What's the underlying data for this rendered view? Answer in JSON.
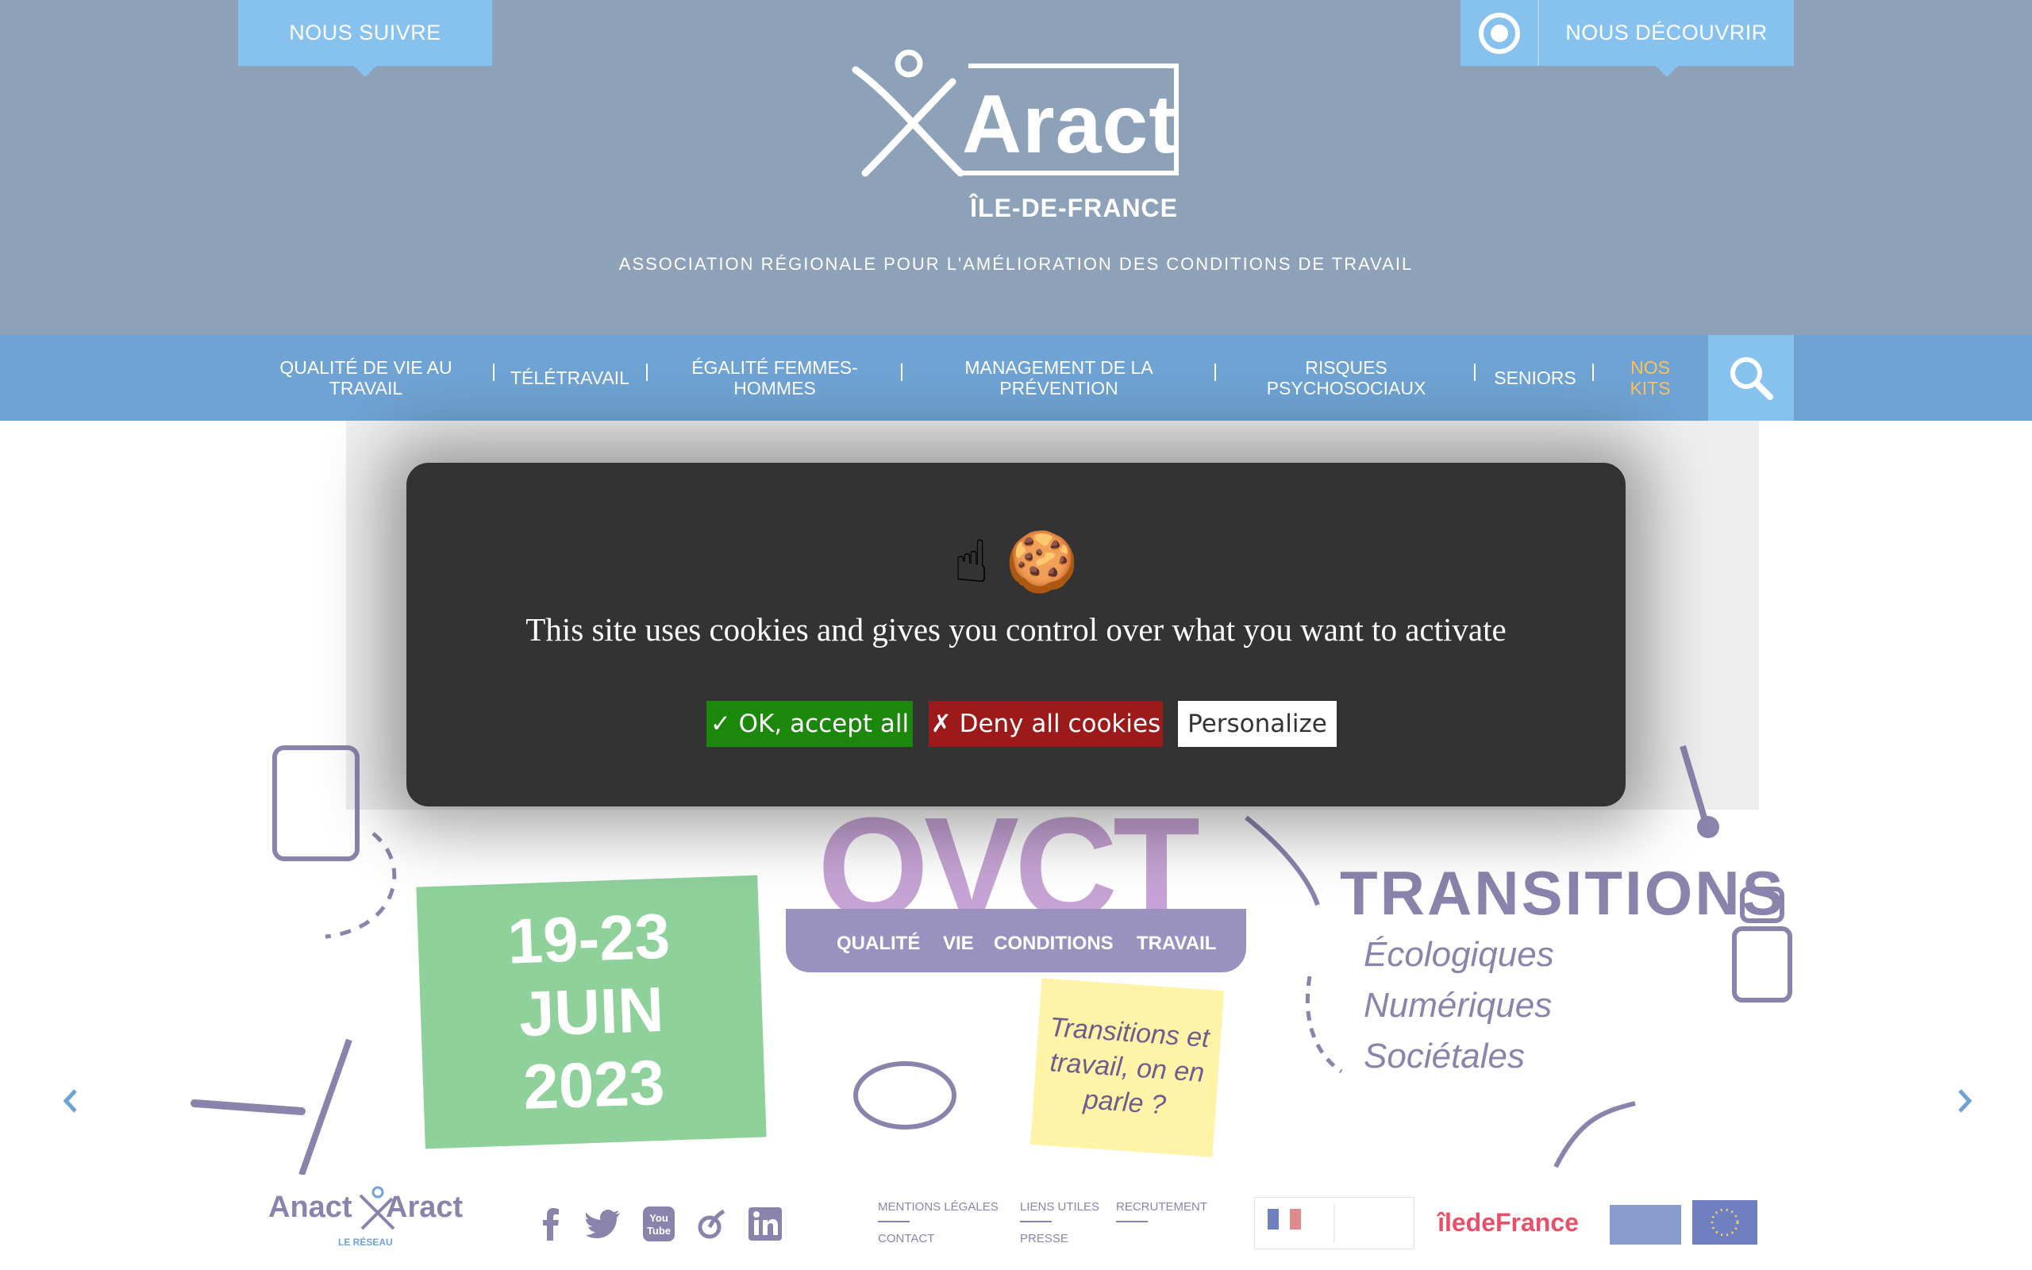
{
  "header": {
    "follow_label": "NOUS SUIVRE",
    "discover_label": "NOUS DÉCOUVRIR",
    "logo_word": "Aract",
    "logo_region": "ÎLE-DE-FRANCE",
    "tagline": "ASSOCIATION RÉGIONALE POUR L'AMÉLIORATION DES CONDITIONS DE TRAVAIL"
  },
  "nav": {
    "items": [
      {
        "label": "QUALITÉ DE VIE AU TRAVAIL"
      },
      {
        "label": "TÉLÉTRAVAIL"
      },
      {
        "label": "ÉGALITÉ FEMMES-HOMMES"
      },
      {
        "label": "MANAGEMENT DE LA PRÉVENTION"
      },
      {
        "label": "RISQUES PSYCHOSOCIAUX"
      },
      {
        "label": "SENIORS"
      },
      {
        "label": "NOS KITS"
      }
    ]
  },
  "hero": {
    "date_line1": "19-23",
    "date_line2": "JUIN",
    "date_line3": "2023",
    "qvct_letters": "QVCT",
    "qvct_q": "QUALITÉ",
    "qvct_v": "VIE",
    "qvct_c": "CONDITIONS",
    "qvct_t": "TRAVAIL",
    "postit_text": "Transitions et travail, on en parle ?",
    "transitions_title": "TRANSITIONS",
    "transitions_items": [
      "Écologiques",
      "Numériques",
      "Sociétales"
    ]
  },
  "cookie": {
    "emoji": "☝ 🍪",
    "message": "This site uses cookies and gives you control over what you want to activate",
    "accept_label": "✓ OK, accept all",
    "deny_label": "✗ Deny all cookies",
    "personalize_label": "Personalize",
    "accept_color": "#1b870b",
    "deny_color": "#9c1a1a"
  },
  "footer": {
    "anact_left": "Anact",
    "anact_right": "Aract",
    "anact_reseau": "LE RÉSEAU",
    "links": {
      "mentions": "MENTIONS LÉGALES",
      "liens": "LIENS UTILES",
      "recrutement": "RECRUTEMENT",
      "contact": "CONTACT",
      "presse": "PRESSE"
    },
    "partner_idf": "îledeFrance"
  },
  "icons": {
    "headset": "headset-icon",
    "search": "search-icon",
    "facebook": "facebook-icon",
    "twitter": "twitter-icon",
    "youtube": "youtube-icon",
    "vimeo": "vimeo-icon",
    "linkedin": "linkedin-icon"
  },
  "colors": {
    "header_bg": "#8da2b8",
    "nav_bg": "#6fa3d3",
    "accent_light_blue": "#87c2ef",
    "nav_highlight": "#f7c35e",
    "cookie_bg": "#333333"
  }
}
